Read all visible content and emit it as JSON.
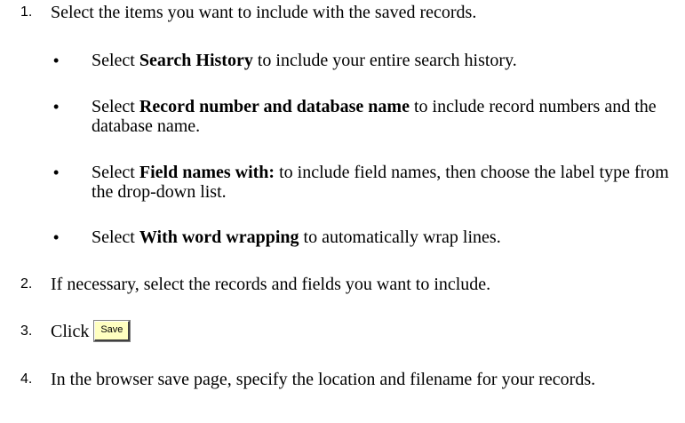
{
  "steps": [
    {
      "number": "1.",
      "text": "Select the items you want to include with the saved records."
    },
    {
      "number": "2.",
      "text": "If necessary, select the records and fields you want to include."
    },
    {
      "number": "3.",
      "text": "Click",
      "button_label": "Save"
    },
    {
      "number": "4.",
      "text": "In the browser save page, specify the location and filename for your records."
    }
  ],
  "bullets": [
    {
      "marker": "•",
      "prefix": "Select ",
      "bold": "Search History",
      "suffix": " to include your entire search history."
    },
    {
      "marker": "•",
      "prefix": "Select ",
      "bold": "Record number and database name",
      "suffix": " to include record numbers and the database name."
    },
    {
      "marker": "•",
      "prefix": "Select ",
      "bold": "Field names with:",
      "suffix": " to include field names, then choose the label type from the drop-down list."
    },
    {
      "marker": "•",
      "prefix": "Select ",
      "bold": "With word wrapping",
      "suffix": " to automatically wrap lines."
    }
  ],
  "colors": {
    "save_button_background": "#ffffc0"
  }
}
